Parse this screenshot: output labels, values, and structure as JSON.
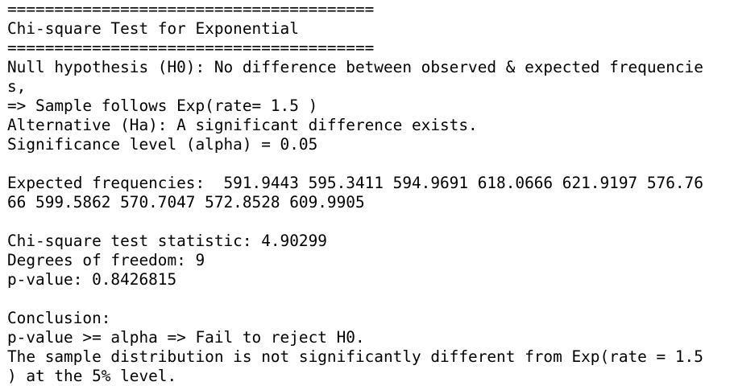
{
  "header": {
    "rule_top": "=======================================",
    "title": "Chi-square Test for Exponential",
    "rule_bottom": "======================================="
  },
  "hypotheses": {
    "null_line1": "Null hypothesis (H0): No difference between observed & expected frequencie",
    "null_line2": "s,",
    "null_line3": "=> Sample follows Exp(rate= 1.5 )",
    "alternative": "Alternative (Ha): A significant difference exists.",
    "significance": "Significance level (alpha) = 0.05"
  },
  "expected": {
    "line1": "Expected frequencies:  591.9443 595.3411 594.9691 618.0666 621.9197 576.76",
    "line2": "66 599.5862 570.7047 572.8528 609.9905"
  },
  "results": {
    "statistic": "Chi-square test statistic: 4.90299",
    "df": "Degrees of freedom: 9",
    "p_value": "p-value: 0.8426815"
  },
  "conclusion": {
    "heading": "Conclusion:",
    "decision": "p-value >= alpha => Fail to reject H0.",
    "summary_line1": "The sample distribution is not significantly different from Exp(rate = 1.5",
    "summary_line2": ") at the 5% level."
  }
}
